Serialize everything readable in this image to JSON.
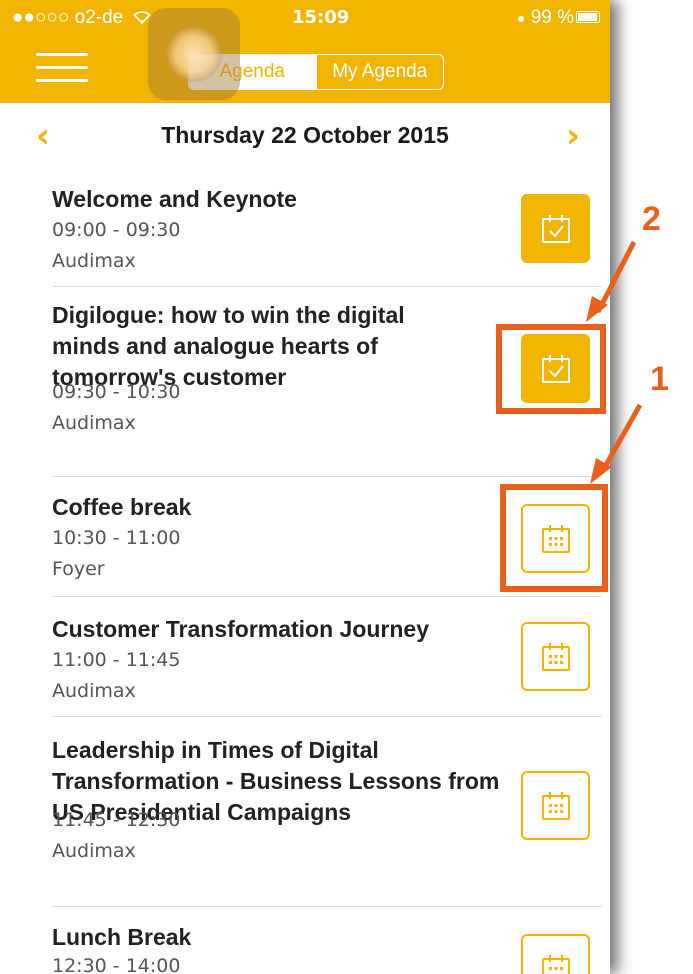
{
  "status_bar": {
    "carrier": "●●○○○ o2-de",
    "time": "15:09",
    "battery": "99 %"
  },
  "header": {
    "tabs": [
      {
        "label": "Agenda",
        "active": true
      },
      {
        "label": "My Agenda",
        "active": false
      }
    ]
  },
  "date_nav": {
    "date": "Thursday 22 October 2015",
    "prev_icon": "chevron-left-icon",
    "next_icon": "chevron-right-icon"
  },
  "agenda": [
    {
      "title": "Welcome and Keynote",
      "time": "09:00 - 09:30",
      "room": "Audimax",
      "in_my_agenda": true
    },
    {
      "title": "Digilogue: how to win the digital minds and analogue hearts of tomorrow's customer",
      "time": "09:30 - 10:30",
      "room": "Audimax",
      "in_my_agenda": true
    },
    {
      "title": "Coffee break",
      "time": "10:30 - 11:00",
      "room": "Foyer",
      "in_my_agenda": false
    },
    {
      "title": "Customer Transformation Journey",
      "time": "11:00 - 11:45",
      "room": "Audimax",
      "in_my_agenda": false
    },
    {
      "title": "Leadership in Times of Digital Transformation - Business Lessons from US Presidential Campaigns",
      "time": "11:45 - 12:30",
      "room": "Audimax",
      "in_my_agenda": false
    },
    {
      "title": "Lunch Break",
      "time": "12:30 - 14:00",
      "room": "",
      "in_my_agenda": false
    }
  ],
  "annotations": {
    "label_1": "1",
    "label_2": "2"
  },
  "colors": {
    "accent": "#f1b400",
    "highlight": "#e8601c"
  }
}
